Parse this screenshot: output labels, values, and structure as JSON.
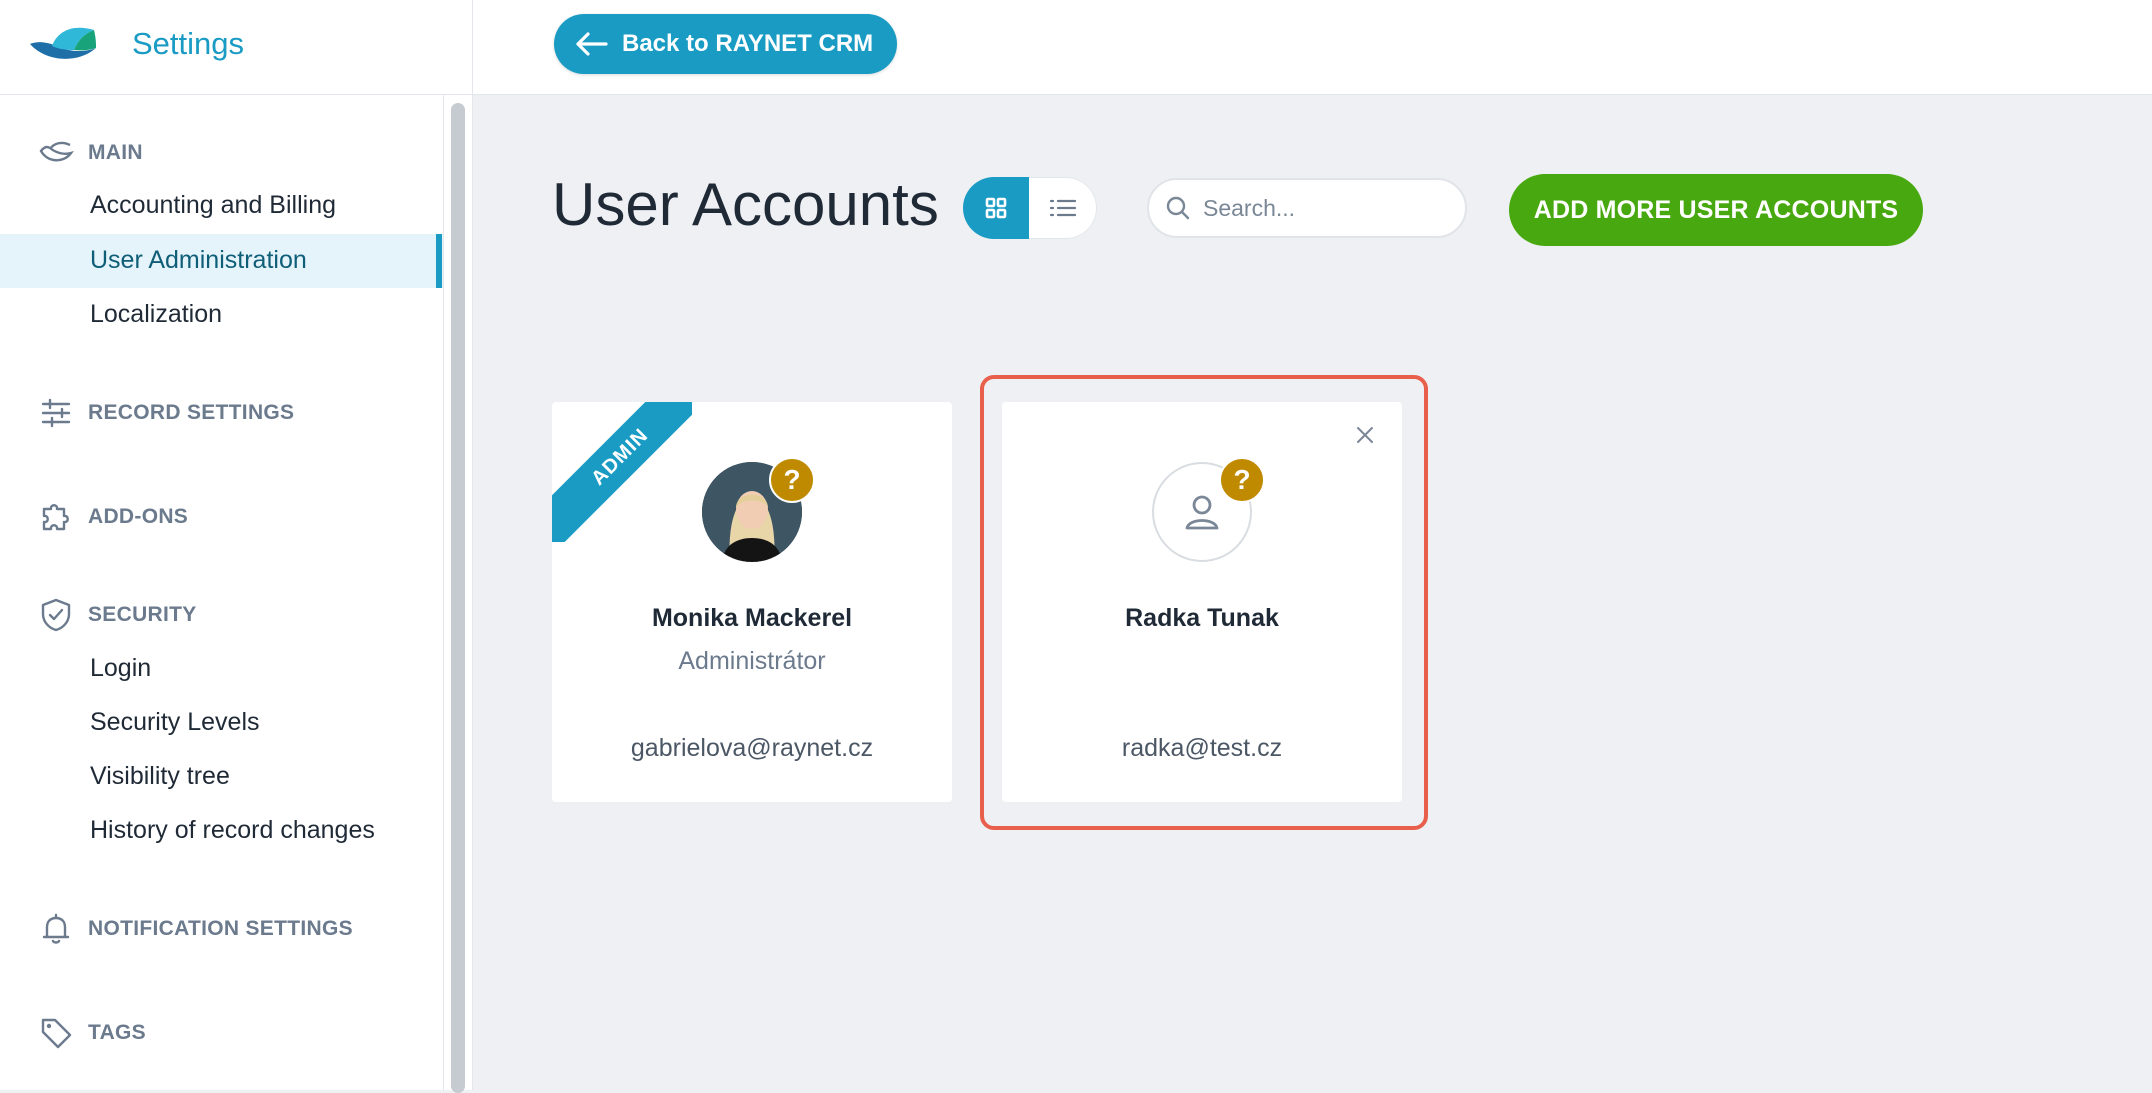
{
  "header": {
    "app_title": "Settings",
    "back_label": "Back to RAYNET CRM"
  },
  "sidebar": {
    "sections": [
      {
        "title": "MAIN",
        "icon": "raynet-mark-icon",
        "items": [
          "Accounting and Billing",
          "User Administration",
          "Localization"
        ]
      },
      {
        "title": "RECORD SETTINGS",
        "icon": "sliders-icon"
      },
      {
        "title": "ADD-ONS",
        "icon": "puzzle-icon"
      },
      {
        "title": "SECURITY",
        "icon": "shield-check-icon",
        "items": [
          "Login",
          "Security Levels",
          "Visibility tree",
          "History of record changes"
        ]
      },
      {
        "title": "NOTIFICATION SETTINGS",
        "icon": "bell-icon"
      },
      {
        "title": "TAGS",
        "icon": "tag-icon"
      }
    ],
    "active_item": "User Administration"
  },
  "main": {
    "title": "User Accounts",
    "search_placeholder": "Search...",
    "add_button": "ADD MORE USER ACCOUNTS",
    "users": [
      {
        "name": "Monika Mackerel",
        "role": "Administrátor",
        "email": "gabrielova@raynet.cz",
        "ribbon": "ADMIN",
        "badge": "?"
      },
      {
        "name": "Radka Tunak",
        "role": "",
        "email": "radka@test.cz",
        "badge": "?"
      }
    ]
  },
  "colors": {
    "primary": "#1a9bc4",
    "add_button": "#47a80f",
    "badge": "#bf8a00",
    "highlight": "#e8604c",
    "background": "#eef0f3"
  }
}
